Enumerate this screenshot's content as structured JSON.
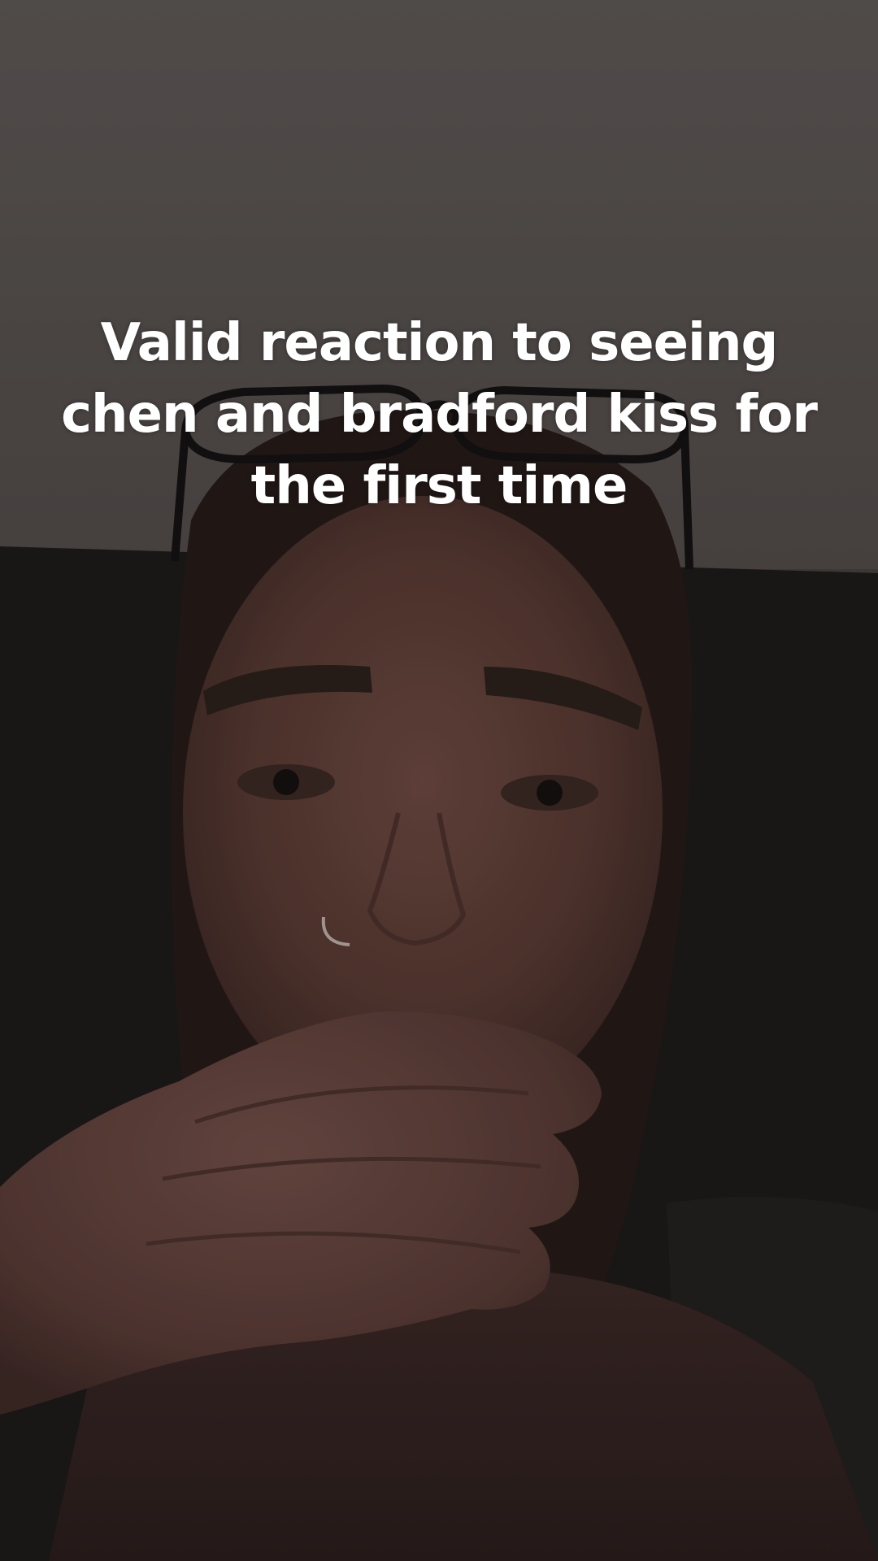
{
  "video": {
    "caption": "Valid reaction to seeing chen and bradford kiss for the first time"
  },
  "scene": {
    "subjects": [
      "person",
      "glasses",
      "nose-ring",
      "hand",
      "couch",
      "wall"
    ],
    "colors": {
      "wall": "#57524f",
      "couch": "#1c1a1a",
      "hair": "#241b19",
      "skin": "#5a3d36",
      "brows": "#2b1f1b"
    }
  }
}
